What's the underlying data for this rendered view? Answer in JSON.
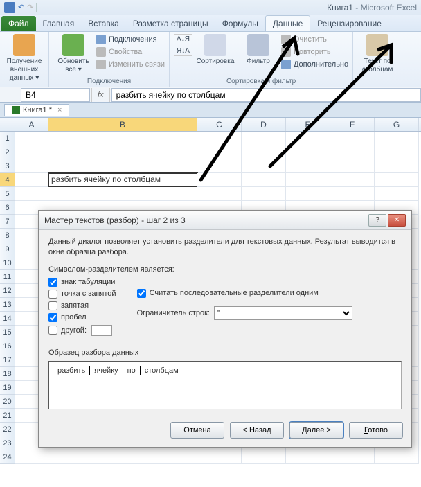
{
  "app": {
    "document": "Книга1",
    "product": "Microsoft Excel"
  },
  "ribbon_tabs": {
    "file": "Файл",
    "home": "Главная",
    "insert": "Вставка",
    "layout": "Разметка страницы",
    "formulas": "Формулы",
    "data": "Данные",
    "review": "Рецензирование"
  },
  "ribbon": {
    "get_external": "Получение внешних данных ▾",
    "refresh": "Обновить все ▾",
    "connections": "Подключения",
    "properties": "Свойства",
    "edit_links": "Изменить связи",
    "group1_label": "Подключения",
    "sort": "Сортировка",
    "filter": "Фильтр",
    "clear": "Очистить",
    "reapply": "Повторить",
    "advanced": "Дополнительно",
    "group2_label": "Сортировка и фильтр",
    "text_to_cols": "Текст по столбцам"
  },
  "namebox": "B4",
  "formula": "разбить ячейку по столбцам",
  "doc_tab": "Книга1 *",
  "columns": [
    "A",
    "B",
    "C",
    "D",
    "E",
    "F",
    "G"
  ],
  "rows_visible": 24,
  "active_cell": {
    "row": 4,
    "col": "B",
    "text": "разбить ячейку по столбцам"
  },
  "dialog": {
    "title": "Мастер текстов (разбор) - шаг 2 из 3",
    "intro": "Данный диалог позволяет установить разделители для текстовых данных. Результат выводится в окне образца разбора.",
    "delim_label": "Символом-разделителем является:",
    "tab": "знак табуляции",
    "semicolon": "точка с запятой",
    "comma": "запятая",
    "space": "пробел",
    "other": "другой:",
    "consecutive": "Считать последовательные разделители одним",
    "qualifier_label": "Ограничитель строк:",
    "qualifier_value": "\"",
    "preview_label": "Образец разбора данных",
    "preview_cells": [
      "разбить",
      "ячейку",
      "по",
      "столбцам"
    ],
    "checked": {
      "tab": true,
      "semicolon": false,
      "comma": false,
      "space": true,
      "other": false,
      "consecutive": true
    },
    "btn_cancel": "Отмена",
    "btn_back": "< Назад",
    "btn_next": "Далее >",
    "btn_finish": "Готово"
  }
}
